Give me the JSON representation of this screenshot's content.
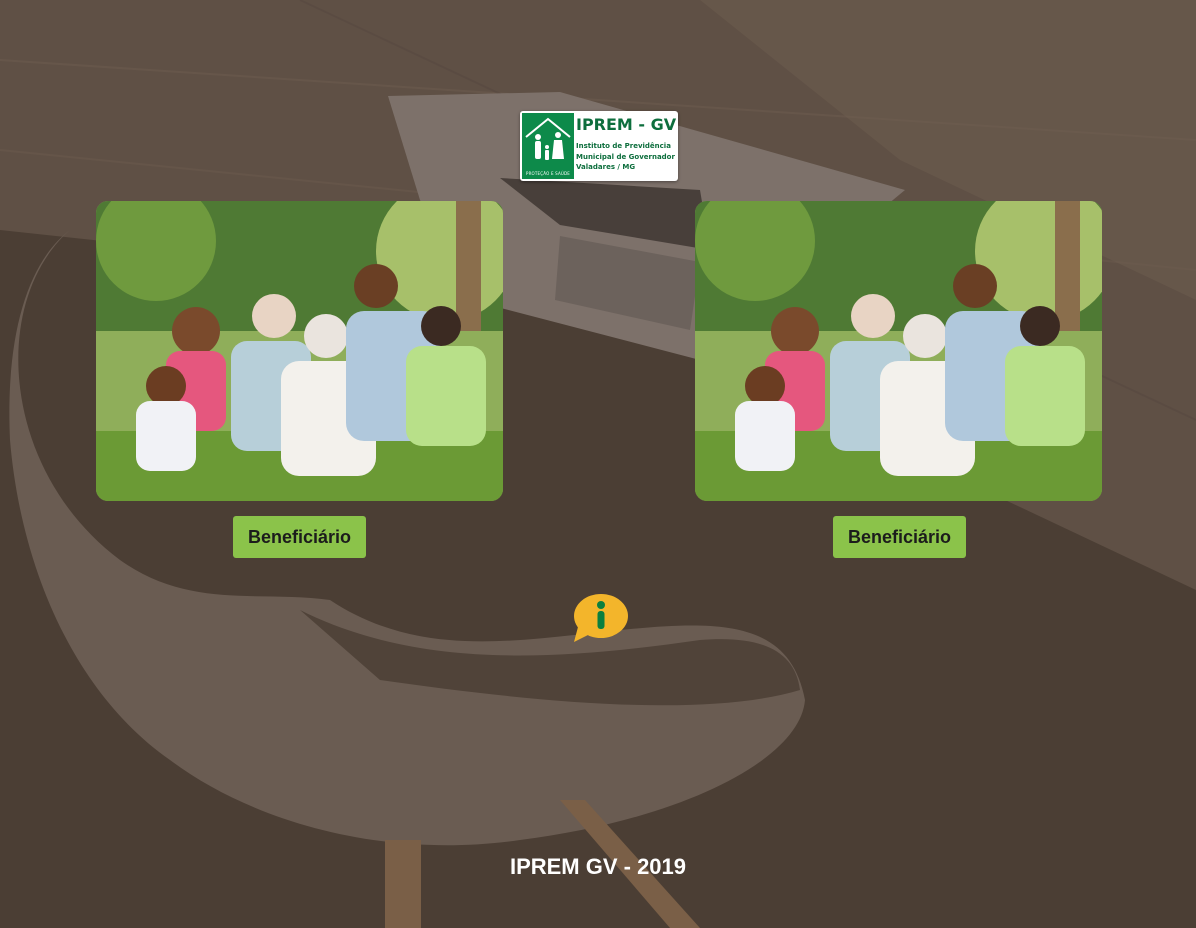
{
  "logo": {
    "name": "IPREM - GV",
    "subtitle_line1": "Instituto de Previdência",
    "subtitle_line2": "Municipal de Governador",
    "subtitle_line3": "Valadares / MG",
    "tagline": "PROTEÇÃO E SAÚDE",
    "brand_color": "#0d8a4a"
  },
  "cards": [
    {
      "image_alt": "family-photo",
      "button_label": "Beneficiário"
    },
    {
      "image_alt": "family-photo",
      "button_label": "Beneficiário"
    }
  ],
  "info_icon": "info-icon",
  "footer": {
    "text": "IPREM GV - 2019"
  },
  "colors": {
    "button": "#8bc34a",
    "info": "#f3b52b",
    "background": "#4a3d33"
  }
}
